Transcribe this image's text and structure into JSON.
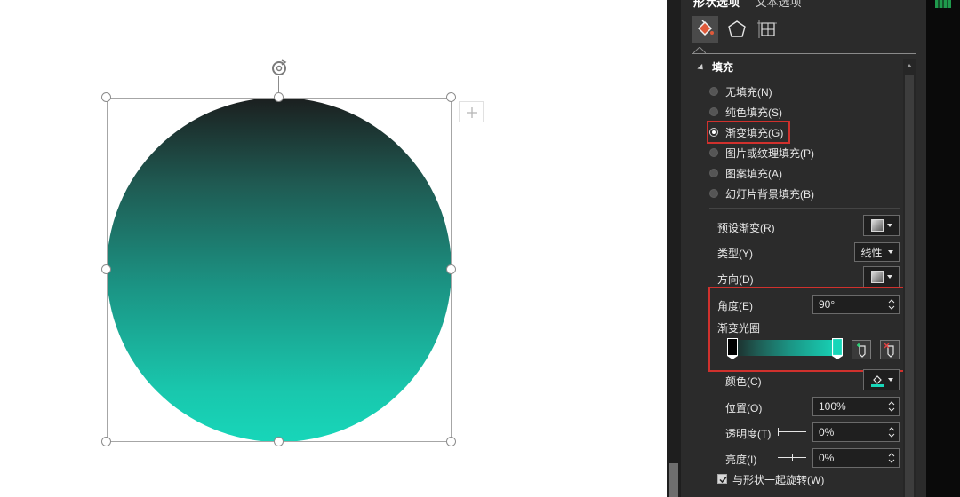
{
  "panel": {
    "tabs": [
      "形状选项",
      "文本选项"
    ],
    "section_title": "填充",
    "fill_options": [
      {
        "label": "无填充(N)",
        "checked": false
      },
      {
        "label": "纯色填充(S)",
        "checked": false
      },
      {
        "label": "渐变填充(G)",
        "checked": true
      },
      {
        "label": "图片或纹理填充(P)",
        "checked": false
      },
      {
        "label": "图案填充(A)",
        "checked": false
      },
      {
        "label": "幻灯片背景填充(B)",
        "checked": false
      }
    ],
    "preset_gradient_label": "预设渐变(R)",
    "type_label": "类型(Y)",
    "type_value": "线性",
    "direction_label": "方向(D)",
    "angle_label": "角度(E)",
    "angle_value": "90°",
    "gradient_stops_label": "渐变光圈",
    "color_label": "颜色(C)",
    "position_label": "位置(O)",
    "position_value": "100%",
    "transparency_label": "透明度(T)",
    "transparency_value": "0%",
    "brightness_label": "亮度(I)",
    "brightness_value": "0%",
    "rotate_with_shape_label": "与形状一起旋转(W)",
    "rotate_with_shape_checked": true
  },
  "colors": {
    "gradient_start": "#1b1f1f",
    "gradient_end": "#17d6b9",
    "highlight_red": "#d0312d",
    "panel_bg": "#2b2b2b"
  }
}
